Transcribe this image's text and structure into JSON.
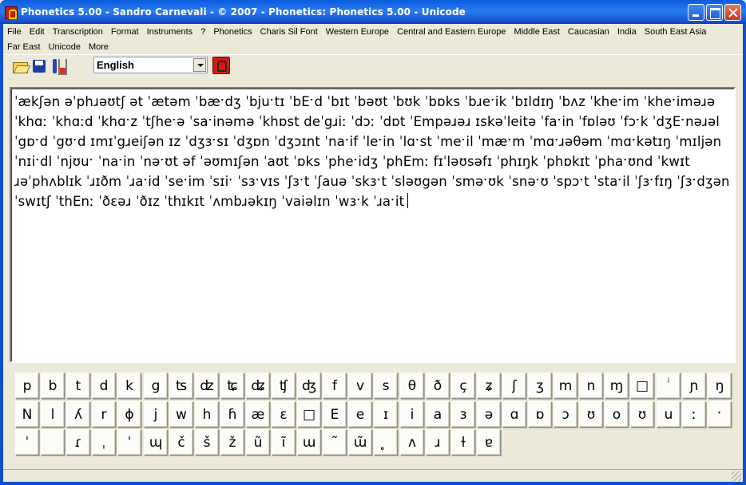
{
  "window": {
    "title": "Phonetics 5.00 - Sandro Carnevali - ©  2007 - Phonetics: Phonetics 5.00 - Unicode"
  },
  "menu": {
    "row1": [
      "File",
      "Edit",
      "Transcription",
      "Format",
      "Instruments",
      "?",
      "Phonetics",
      "Charis Sil Font",
      "Western Europe",
      "Central and Eastern Europe",
      "Middle East",
      "Caucasian",
      "India",
      "South East Asia"
    ],
    "row2": [
      "Far East",
      "Unicode",
      "More"
    ]
  },
  "toolbar": {
    "language_value": "English",
    "icons": [
      "open-folder-icon",
      "save-disk-icon",
      "tool-icon",
      "record-icon"
    ]
  },
  "editor": {
    "lines": [
      "ˈækʃən əˈphɹəʊtʃ ət ˈætəm ˈbæˑdʒ ˈbjuˑtɪ ˈbEˑd ˈbɪt ˈbəʊt ˈbʊk ˈbɒks ˈbɹeˑik ˈbɪldɪŋ ˈbʌz ˈkheˑim ˈkheˑiməɹə",
      "ˈkhɑː ˈkhɑːd ˈkhɑˑz ˈtʃheˑə ˈsaˑinəmə ˈkhɒst deˈgɹiː ˈdɔː ˈdɒt ˈEmpəɹəɹ ɪskəˈleitə ˈfaˑin ˈfɒləʊ ˈfɔˑk ˈdʒEˑnəɹəl",
      "ˈgɒˑd ˈgʊˑd ɪmɪˈgɹeiʃən ɪz ˈdʒɜˑsɪ ˈdʒɒn ˈdʒɔɪnt ˈnaˑif ˈleˑin ˈlɑˑst ˈmeˑil ˈmæˑm ˈmɑˑɹəθəm ˈmɑˑkətɪŋ ˈmɪljən",
      "ˈnɪiˑdl ˈnjʊuˑ ˈnaˑin ˈnəˑʊt əf ˈəʊmɪʃən ˈaʊt ˈɒks ˈpheˑidʒ ˈphEmː fɪˈləʊsəfɪ ˈphɪŋk ˈphɒkɪt ˈphaˑʊnd ˈkwɪt",
      "ɹəˈphʌblɪk ˈɹɪðm ˈɹaˑid ˈseˑim ˈsɪiˑ ˈsɜˑvɪs ˈʃɜˑt ˈʃauə ˈskɜˑt ˈsləʊgən ˈsməˑʊk ˈsnəˑʊ ˈspɔˑt ˈstaˑil ˈʃɜˑfɪŋ ˈʃɜˑdʒən",
      "ˈswɪtʃ ˈthEnː ˈðɛəɹ ˈðɪz ˈthɪkɪt ˈʌmbɹəkɪŋ ˈvaiəlɪn ˈwɜˑk ˈɹaˑit"
    ]
  },
  "keyboard": {
    "row1": [
      "p",
      "b",
      "t",
      "d",
      "k",
      "g",
      "ʦ",
      "ʣ",
      "ʨ",
      "ʥ",
      "ʧ",
      "ʤ",
      "f",
      "v",
      "s",
      "θ",
      "ð",
      "ç",
      "ʑ",
      "ʃ",
      "ʒ",
      "m",
      "n",
      "ɱ",
      "□",
      "ʲ",
      "ɲ",
      "ŋ"
    ],
    "row2": [
      "N",
      "l",
      "ʎ",
      "r",
      "ɸ",
      "j",
      "w",
      "h",
      "ɦ",
      "æ",
      "ɛ",
      "□",
      "E",
      "e",
      "ɪ",
      "i",
      "a",
      "ɜ",
      "ə",
      "ɑ",
      "ɒ",
      "ɔ",
      "ʊ",
      "o",
      "ʊ",
      "u",
      "ː",
      "ˑ"
    ],
    "row3": [
      "ˈ",
      "",
      "ɾ",
      "ˌ",
      "ˈ",
      "ɰ",
      "č",
      "š",
      "ž",
      "ũ",
      "ĩ",
      "ɯ",
      "˜",
      "ɯ̃",
      "̥",
      "ʌ",
      "ɹ",
      "ɫ",
      "ɐ"
    ]
  }
}
